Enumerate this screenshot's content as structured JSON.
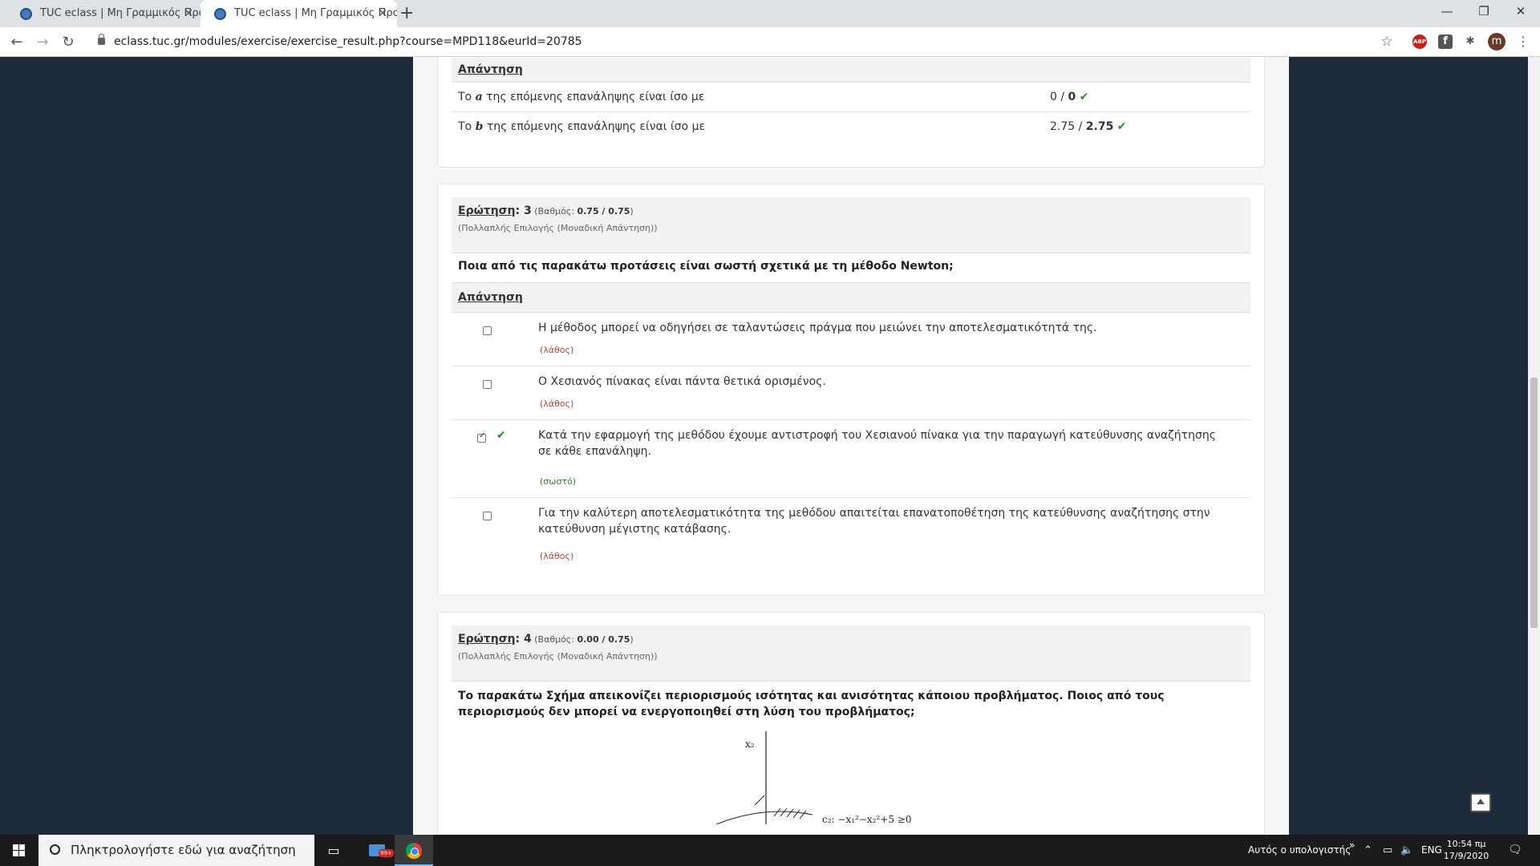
{
  "browser": {
    "tabs": [
      {
        "title": "TUC eclass | Μη Γραμμικός Προγ"
      },
      {
        "title": "TUC eclass | Μη Γραμμικός Προγ"
      }
    ],
    "new_tab": "+",
    "close_glyph": "✕",
    "window_controls": {
      "minimize": "—",
      "restore": "❐",
      "close": "✕"
    },
    "url": "eclass.tuc.gr/modules/exercise/exercise_result.php?course=MPD118&eurId=20785",
    "extensions": {
      "abp": "ABP",
      "facebook": "f",
      "puzzle": "✱",
      "avatar": "m"
    }
  },
  "q2_tail": {
    "answer_header": "Απάντηση",
    "rows": [
      {
        "prefix": "Το ",
        "var": "a",
        "suffix": " της επόμενης επανάληψης είναι ίσο με",
        "given": "0",
        "correct": "0"
      },
      {
        "prefix": "Το ",
        "var": "b",
        "suffix": " της επόμενης επανάληψης είναι ίσο με",
        "given": "2.75",
        "correct": "2.75"
      }
    ]
  },
  "q3": {
    "label": "Ερώτηση",
    "number": ": 3",
    "grade_prefix": " (Βαθμός: ",
    "grade": "0.75 / 0.75",
    "grade_suffix": ")",
    "type": "(Πολλαπλής Επιλογής (Μοναδική Απάντηση))",
    "text": "Ποια από τις παρακάτω προτάσεις είναι σωστή σχετικά με τη μέθοδο Newton;",
    "answer_header": "Απάντηση",
    "options": [
      {
        "text": "Η μέθοδος μπορεί να οδηγήσει σε ταλαντώσεις πράγμα που μειώνει την αποτελεσματικότητά της.",
        "feedback": "(λάθος)"
      },
      {
        "text": "Ο Χεσιανός πίνακας είναι πάντα θετικά ορισμένος.",
        "feedback": "(λάθος)"
      },
      {
        "text": "Κατά την εφαρμογή της μεθόδου έχουμε αντιστροφή του Χεσιανού πίνακα για την παραγωγή κατεύθυνσης αναζήτησης σε κάθε επανάληψη.",
        "feedback": "(σωστό)"
      },
      {
        "text": "Για την καλύτερη αποτελεσματικότητα της μεθόδου απαιτείται επανατοποθέτηση της κατεύθυνσης αναζήτησης στην κατεύθυνση μέγιστης κατάβασης.",
        "feedback": "(λάθος)"
      }
    ]
  },
  "q4": {
    "label": "Ερώτηση",
    "number": ": 4",
    "grade_prefix": " (Βαθμός: ",
    "grade": "0.00 / 0.75",
    "grade_suffix": ")",
    "type": "(Πολλαπλής Επιλογής (Μοναδική Απάντηση))",
    "text": "Το παρακάτω Σχήμα απεικονίζει περιορισμούς ισότητας και ανισότητας κάποιου προβλήματος. Ποιος από τους περιορισμούς δεν μπορεί να ενεργοποιηθεί στη λύση του προβλήματος;",
    "figure": {
      "axis_label": "x₂",
      "constraint_label": "c₂: −x₁²−x₂²+5 ≥0"
    }
  },
  "taskbar": {
    "search_placeholder": "Πληκτρολογήστε εδώ για αναζήτηση",
    "tray_text": "Αυτός ο υπολογιστής",
    "chevron": "»",
    "lang": "ENG",
    "time": "10:54 πμ",
    "date": "17/9/2020",
    "mail_badge": "99+"
  }
}
